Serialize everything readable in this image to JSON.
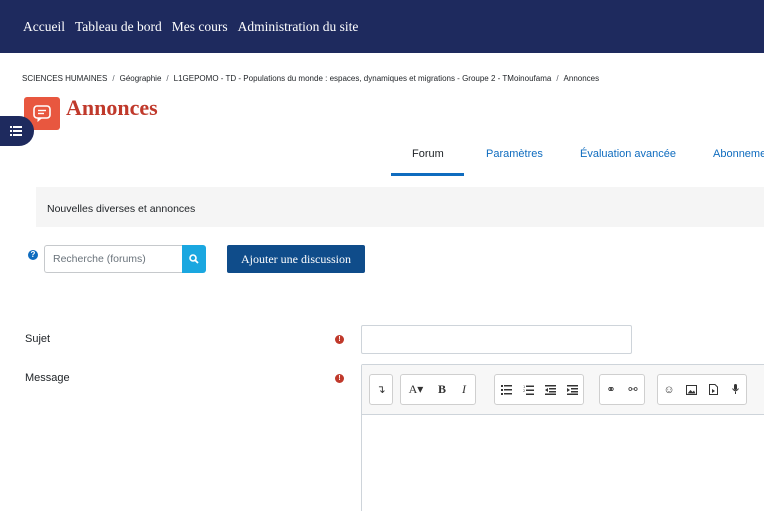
{
  "navbar": {
    "items": [
      "Accueil",
      "Tableau de bord",
      "Mes cours",
      "Administration du site"
    ]
  },
  "breadcrumb": [
    "SCIENCES HUMAINES",
    "Géographie",
    "L1GEPOMO - TD - Populations du monde : espaces, dynamiques et migrations - Groupe 2 - TMoinoufama",
    "Annonces"
  ],
  "page": {
    "title": "Annonces"
  },
  "tabs": [
    "Forum",
    "Paramètres",
    "Évaluation avancée",
    "Abonneme"
  ],
  "forum_intro": "Nouvelles diverses et annonces",
  "search": {
    "placeholder": "Recherche (forums)"
  },
  "add_discussion_label": "Ajouter une discussion",
  "form": {
    "subject_label": "Sujet",
    "message_label": "Message"
  },
  "colors": {
    "navbar": "#1e2a5e",
    "title": "#c0392b",
    "accent": "#0f6cbf",
    "search_button": "#1aa7e0",
    "primary_button": "#0f4c8a",
    "required": "#c0392b"
  },
  "icons": [
    "forum-icon",
    "menu-icon",
    "help-icon",
    "search-icon",
    "required-icon",
    "text-style-icon",
    "font-color-icon",
    "bold-icon",
    "italic-icon",
    "unordered-list-icon",
    "ordered-list-icon",
    "outdent-icon",
    "indent-icon",
    "link-icon",
    "unlink-icon",
    "emoticon-icon",
    "image-icon",
    "media-icon",
    "record-audio-icon"
  ]
}
